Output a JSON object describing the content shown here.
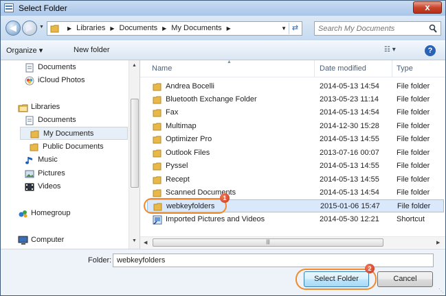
{
  "window": {
    "title": "Select Folder",
    "close_label": "x"
  },
  "address": {
    "crumbs": [
      "Libraries",
      "Documents",
      "My Documents"
    ],
    "search_placeholder": "Search My Documents"
  },
  "toolbar": {
    "organize": "Organize ▾",
    "new_folder": "New folder",
    "view": "☷ ▾",
    "help": "?"
  },
  "nav": {
    "items": [
      {
        "label": "Documents",
        "icon": "document-icon"
      },
      {
        "label": "iCloud Photos",
        "icon": "icloud-icon"
      },
      {
        "label": "Libraries",
        "icon": "libraries-icon"
      },
      {
        "label": "Documents",
        "icon": "documents-library-icon"
      },
      {
        "label": "My Documents",
        "icon": "folder-icon",
        "selected": true
      },
      {
        "label": "Public Documents",
        "icon": "folder-icon"
      },
      {
        "label": "Music",
        "icon": "music-icon"
      },
      {
        "label": "Pictures",
        "icon": "pictures-icon"
      },
      {
        "label": "Videos",
        "icon": "videos-icon"
      },
      {
        "label": "Homegroup",
        "icon": "homegroup-icon"
      },
      {
        "label": "Computer",
        "icon": "computer-icon"
      }
    ]
  },
  "files": {
    "columns": [
      "Name",
      "Date modified",
      "Type"
    ],
    "rows": [
      {
        "name": "Andrea Bocelli",
        "date": "2014-05-13 14:54",
        "type": "File folder"
      },
      {
        "name": "Bluetooth Exchange Folder",
        "date": "2013-05-23 11:14",
        "type": "File folder"
      },
      {
        "name": "Fax",
        "date": "2014-05-13 14:54",
        "type": "File folder"
      },
      {
        "name": "Multimap",
        "date": "2014-12-30 15:28",
        "type": "File folder"
      },
      {
        "name": "Optimizer Pro",
        "date": "2014-05-13 14:55",
        "type": "File folder"
      },
      {
        "name": "Outlook Files",
        "date": "2013-07-16 00:07",
        "type": "File folder"
      },
      {
        "name": "Pyssel",
        "date": "2014-05-13 14:55",
        "type": "File folder"
      },
      {
        "name": "Recept",
        "date": "2014-05-13 14:55",
        "type": "File folder"
      },
      {
        "name": "Scanned Documents",
        "date": "2014-05-13 14:54",
        "type": "File folder"
      },
      {
        "name": "webkeyfolders",
        "date": "2015-01-06 15:47",
        "type": "File folder",
        "selected": true
      },
      {
        "name": "Imported Pictures and Videos",
        "date": "2014-05-30 12:21",
        "type": "Shortcut"
      }
    ]
  },
  "bottom": {
    "folder_label": "Folder:",
    "folder_value": "webkeyfolders",
    "select_button": "Select Folder",
    "cancel_button": "Cancel"
  },
  "annotations": {
    "badge1": "1",
    "badge2": "2"
  },
  "colors": {
    "highlight": "#f08a2a",
    "selection": "#d9e8fb",
    "folder": "#e8b84a"
  }
}
